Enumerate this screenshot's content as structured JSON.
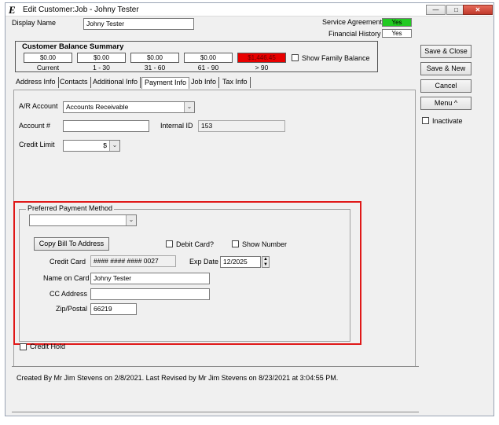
{
  "window": {
    "title": "Edit Customer:Job - Johny Tester",
    "minimize_glyph": "—",
    "maximize_glyph": "□",
    "close_glyph": "✕",
    "app_icon_glyph": "E"
  },
  "header": {
    "display_name_label": "Display Name",
    "display_name_value": "Johny Tester",
    "service_agreement_label": "Service Agreement",
    "service_agreement_value": "Yes",
    "financial_history_label": "Financial History",
    "financial_history_value": "Yes"
  },
  "balance_summary": {
    "title": "Customer Balance Summary",
    "amounts": [
      "$0.00",
      "$0.00",
      "$0.00",
      "$0.00",
      "$1,446.45"
    ],
    "captions": [
      "Current",
      "1 - 30",
      "31 - 60",
      "61 - 90",
      "> 90"
    ],
    "show_family_balance_label": "Show Family Balance"
  },
  "tabs": [
    "Address Info",
    "Contacts",
    "Additional Info",
    "Payment Info",
    "Job Info",
    "Tax Info"
  ],
  "active_tab": "Payment Info",
  "payment_info": {
    "ar_account_label": "A/R Account",
    "ar_account_value": "Accounts Receivable",
    "account_number_label": "Account #",
    "account_number_value": "",
    "internal_id_label": "Internal ID",
    "internal_id_value": "153",
    "credit_limit_label": "Credit Limit",
    "credit_limit_value": "$"
  },
  "preferred_payment": {
    "legend": "Preferred Payment Method",
    "method_value": "",
    "copy_bill_button": "Copy Bill To Address",
    "debit_card_label": "Debit Card?",
    "show_number_label": "Show Number",
    "credit_card_label": "Credit Card",
    "credit_card_value": "#### #### #### 0027",
    "exp_date_label": "Exp Date",
    "exp_date_value": "12/2025",
    "name_on_card_label": "Name on Card",
    "name_on_card_value": "Johny Tester",
    "cc_address_label": "CC Address",
    "cc_address_value": "",
    "zip_label": "Zip/Postal",
    "zip_value": "66219"
  },
  "credit_hold_label": "Credit Hold",
  "actions": {
    "save_close": "Save & Close",
    "save_new": "Save & New",
    "cancel": "Cancel",
    "menu": "Menu ^",
    "inactivate_label": "Inactivate"
  },
  "status_text": "Created By Mr Jim Stevens on 2/8/2021.  Last Revised by Mr Jim Stevens on 8/23/2021 at 3:04:55 PM.",
  "colors": {
    "service_agreement_bg": "#22c922",
    "overdue_bg": "#e80000",
    "highlight_border": "#e01818"
  }
}
